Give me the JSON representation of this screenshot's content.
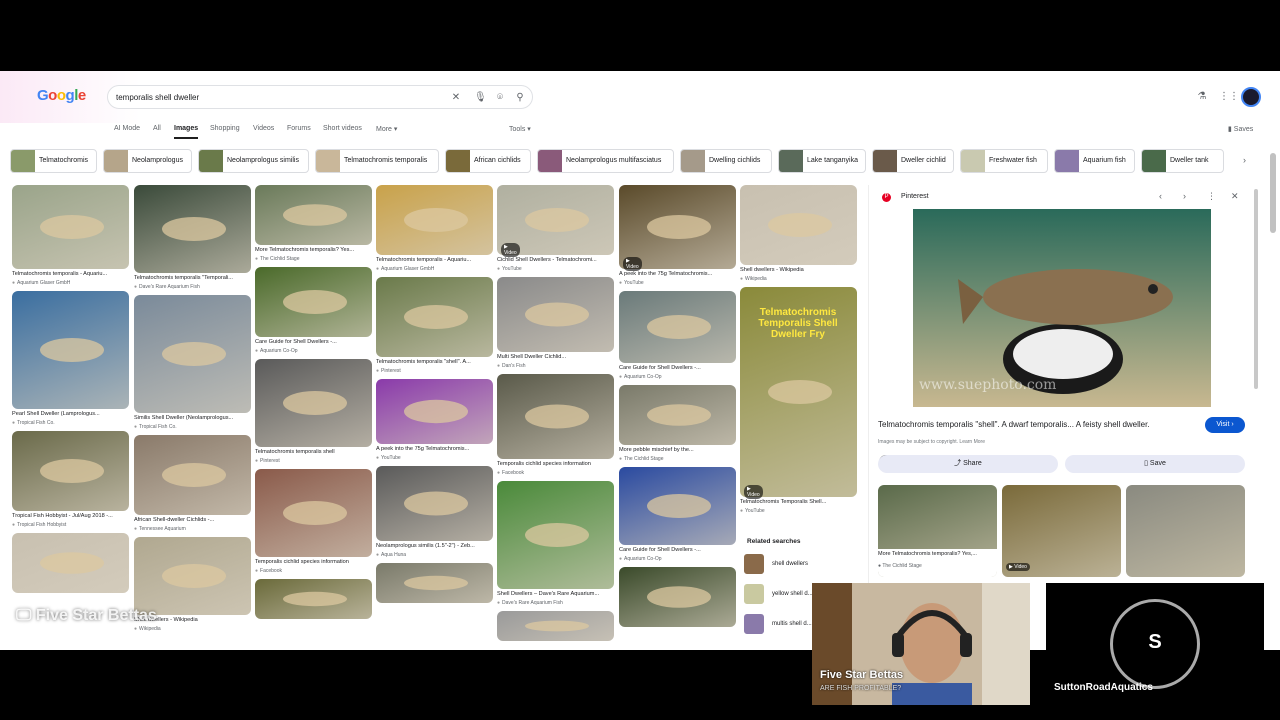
{
  "header": {
    "logo": "Google",
    "search_value": "temporalis shell dweller",
    "icons": [
      "close-icon",
      "mic-icon",
      "lens-icon",
      "search-icon",
      "labs-icon",
      "apps-icon",
      "avatar"
    ]
  },
  "tabs": [
    {
      "label": "AI Mode"
    },
    {
      "label": "All"
    },
    {
      "label": "Images",
      "active": true
    },
    {
      "label": "Shopping"
    },
    {
      "label": "Videos"
    },
    {
      "label": "Forums"
    },
    {
      "label": "Short videos"
    },
    {
      "label": "More ▾"
    },
    {
      "label": "Tools ▾"
    }
  ],
  "saves_label": "Saves",
  "chips": [
    {
      "label": "Telmatochromis",
      "color": "#8a9a6a"
    },
    {
      "label": "Neolamprologus",
      "color": "#b5a58a"
    },
    {
      "label": "Neolamprologus similis",
      "color": "#6a7a4a"
    },
    {
      "label": "Telmatochromis temporalis",
      "color": "#c9b79a"
    },
    {
      "label": "African cichlids",
      "color": "#7a6a3a"
    },
    {
      "label": "Neolamprologus multifasciatus",
      "color": "#8a5a7a"
    },
    {
      "label": "Dwelling cichlids",
      "color": "#a59a8a"
    },
    {
      "label": "Lake tanganyika",
      "color": "#5a6a5a"
    },
    {
      "label": "Dweller cichlid",
      "color": "#6a5a4a"
    },
    {
      "label": "Freshwater fish",
      "color": "#c9c9b0"
    },
    {
      "label": "Aquarium fish",
      "color": "#8a7aaa"
    },
    {
      "label": "Dweller tank",
      "color": "#4a6a4a"
    }
  ],
  "columns": [
    [
      {
        "caption": "Telmatochromis temporalis - Aquariu...",
        "source": "Aquarium Glaser GmbH",
        "color": "#9aa48a"
      },
      {
        "caption": "Pearl Shell Dweller (Lamprologus...",
        "source": "Tropical Fish Co.",
        "color": "#3a6ea0"
      },
      {
        "caption": "Tropical Fish Hobbyist - Jul/Aug 2018 -...",
        "source": "Tropical Fish Hobbyist",
        "color": "#6a6a4a"
      },
      {
        "caption": "",
        "source": "",
        "color": "#c8c0b0"
      }
    ],
    [
      {
        "caption": "Telmatochromis temporalis \"Temporali...",
        "source": "Dave's Rare Aquarium Fish",
        "color": "#3a4a3a"
      },
      {
        "caption": "Similis Shell Dweller (Neolamprologus...",
        "source": "Tropical Fish Co.",
        "color": "#7a8a9a"
      },
      {
        "caption": "African Shell-dweller Cichlids -...",
        "source": "Tennessee Aquarium",
        "color": "#8a7a6a"
      },
      {
        "caption": "Shell dwellers - Wikipedia",
        "source": "Wikipedia",
        "color": "#b0a890"
      }
    ],
    [
      {
        "caption": "More Telmatochromis temporalis? Yes...",
        "source": "The Cichlid Stage",
        "color": "#6a7a5a"
      },
      {
        "caption": "Care Guide for Shell Dwellers -...",
        "source": "Aquarium Co-Op",
        "color": "#4a6a2a"
      },
      {
        "caption": "Telmatochromis temporalis shell",
        "source": "Pinterest",
        "color": "#5a5a5a"
      },
      {
        "caption": "Temporalis cichlid species information",
        "source": "Facebook",
        "color": "#8a5a4a"
      },
      {
        "caption": "",
        "source": "",
        "color": "#6a6a3a"
      }
    ],
    [
      {
        "caption": "Telmatochromis temporalis - Aquariu...",
        "source": "Aquarium Glaser GmbH",
        "color": "#c9a24a"
      },
      {
        "caption": "Telmatochromis temporalis \"shell\". A...",
        "source": "Pinterest",
        "color": "#6a7a4a"
      },
      {
        "caption": "A peek into the 75g Telmatochromis...",
        "source": "YouTube",
        "color": "#8a3aaa"
      },
      {
        "caption": "Neolamprologus similis (1.5\"-2\") - Zeb...",
        "source": "Aqua Huna",
        "color": "#5a5a5a"
      },
      {
        "caption": "",
        "source": "",
        "color": "#7a7a6a"
      }
    ],
    [
      {
        "caption": "Cichlid Shell Dwellers - Telmatochromi...",
        "source": "YouTube",
        "color": "#b0b0a0"
      },
      {
        "caption": "Multi Shell Dweller Cichlid...",
        "source": "Dan's Fish",
        "color": "#8a8a8a"
      },
      {
        "caption": "Temporalis cichlid species information",
        "source": "Facebook",
        "color": "#5a5a4a"
      },
      {
        "caption": "Shell Dwellers – Dave's Rare Aquarium...",
        "source": "Dave's Rare Aquarium Fish",
        "color": "#4a8a3a"
      },
      {
        "caption": "",
        "source": "",
        "color": "#9a9a9a"
      }
    ],
    [
      {
        "caption": "A peek into the 75g Telmatochromis...",
        "source": "YouTube",
        "color": "#5a4a2a"
      },
      {
        "caption": "Care Guide for Shell Dwellers -...",
        "source": "Aquarium Co-Op",
        "color": "#6a7a7a"
      },
      {
        "caption": "More pebble mischief by the...",
        "source": "The Cichlid Stage",
        "color": "#7a7a6a"
      },
      {
        "caption": "Care Guide for Shell Dwellers -...",
        "source": "Aquarium Co-Op",
        "color": "#2a4aa0"
      },
      {
        "caption": "",
        "source": "",
        "color": "#3a4a2a"
      }
    ],
    [
      {
        "caption": "Shell dwellers - Wikipedia",
        "source": "Wikipedia",
        "color": "#c8c0b0"
      },
      {
        "caption": "Telmatochromis Temporalis Shell...",
        "source": "YouTube",
        "color": "#8a8a3a",
        "overlay": "Telmatochromis Temporalis Shell Dweller Fry"
      }
    ]
  ],
  "video_badge": "▶ Video",
  "related": {
    "heading": "Related searches",
    "items": [
      {
        "label": "shell dwellers",
        "color": "#8a6a4a"
      },
      {
        "label": "yellow shell d...",
        "color": "#c9c9a0"
      },
      {
        "label": "multis shell d...",
        "color": "#8a7aaa"
      }
    ]
  },
  "panel": {
    "source": "Pinterest",
    "title": "Telmatochromis temporalis \"shell\". A dwarf temporalis... A feisty shell dweller.",
    "visit_label": "Visit ›",
    "copyright": "Images may be subject to copyright. Learn More",
    "share_label": "Share",
    "save_label": "Save",
    "watermark": "www.suephoto.com",
    "main_color": "#6a6a4a",
    "thumbs": [
      {
        "caption": "More Telmatochromis temporalis? Yes,...",
        "source": "The Cichlid Stage",
        "color": "#5a6a4a"
      },
      {
        "caption": "",
        "source": "",
        "color": "#7a6a3a",
        "badge": "▶ Video"
      },
      {
        "caption": "",
        "source": "",
        "color": "#8a8a80"
      }
    ]
  },
  "overlays": {
    "watermark": "Five Star Bettas",
    "cam_name": "Five Star Bettas",
    "cam_sub": "ARE FISH PROFITABLE?",
    "guest_initial": "S",
    "guest_name": "SuttonRoadAquatics"
  }
}
